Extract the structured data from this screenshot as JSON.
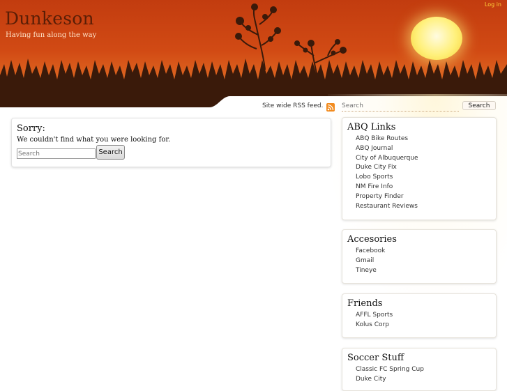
{
  "header": {
    "title": "Dunkeson",
    "tagline": "Having fun along the way",
    "login_label": "Log in"
  },
  "rss": {
    "label": "Site wide RSS feed."
  },
  "sidebar_search": {
    "placeholder": "Search",
    "button_label": "Search"
  },
  "main": {
    "heading": "Sorry:",
    "message": "We couldn't find what you were looking for.",
    "search_placeholder": "Search",
    "search_button": "Search"
  },
  "widgets": [
    {
      "title": "ABQ Links",
      "items": [
        "ABQ Bike Routes",
        "ABQ Journal",
        "City of Albuquerque",
        "Duke City Fix",
        "Lobo Sports",
        "NM Fire Info",
        "Property Finder",
        "Restaurant Reviews"
      ]
    },
    {
      "title": "Accesories",
      "items": [
        "Facebook",
        "Gmail",
        "Tineye"
      ]
    },
    {
      "title": "Friends",
      "items": [
        "AFFL Sports",
        "Kolus Corp"
      ]
    },
    {
      "title": "Soccer Stuff",
      "items": [
        "Classic FC Spring Cup",
        "Duke City"
      ]
    }
  ],
  "colors": {
    "header_top": "#c23c0f",
    "header_bottom": "#e98a3c",
    "sun": "#fff07a",
    "grass": "#3a1a0a",
    "rss": "#f28b1e",
    "login": "#ffd23a"
  },
  "icons": {
    "rss": "rss-feed-icon"
  }
}
